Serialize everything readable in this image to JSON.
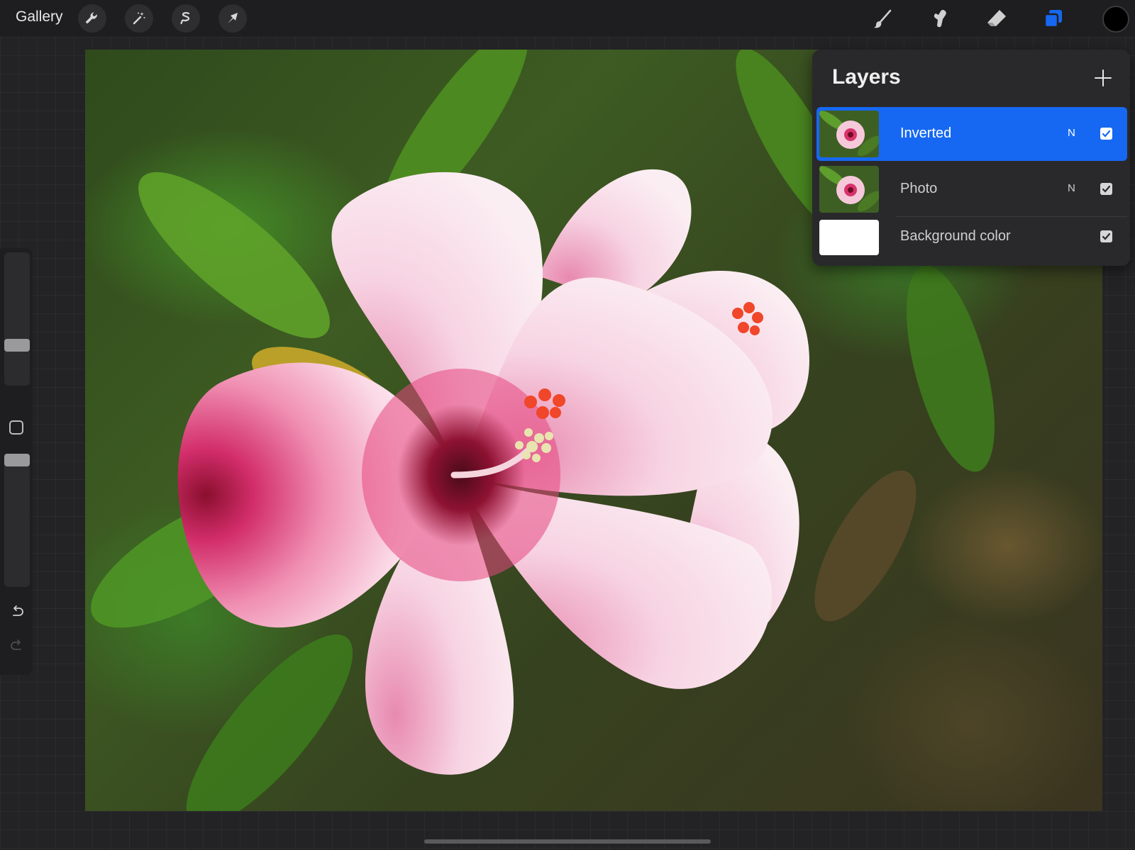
{
  "toolbar": {
    "gallery_label": "Gallery",
    "left_tools": [
      "wrench-icon",
      "magic-wand-icon",
      "selection-icon",
      "transform-arrow-icon"
    ],
    "right_tools": [
      "brush-icon",
      "smudge-icon",
      "eraser-icon",
      "layers-icon"
    ],
    "active_tool": "layers-icon",
    "current_color": "#000000",
    "accent_color": "#1668f2"
  },
  "layers_panel": {
    "title": "Layers",
    "add_icon": "plus-icon",
    "layers": [
      {
        "name": "Inverted",
        "blend_mode": "N",
        "visible": true,
        "active": true
      },
      {
        "name": "Photo",
        "blend_mode": "N",
        "visible": true,
        "active": false
      },
      {
        "name": "Background color",
        "blend_mode": "",
        "visible": true,
        "active": false
      }
    ]
  },
  "sidebar": {
    "brush_size_level": 0.28,
    "opacity_level": 1.0,
    "modify_icon": "square-modify-icon",
    "undo_icon": "undo-icon",
    "redo_icon": "redo-icon"
  },
  "canvas": {
    "subject": "pink-hibiscus-flower"
  }
}
